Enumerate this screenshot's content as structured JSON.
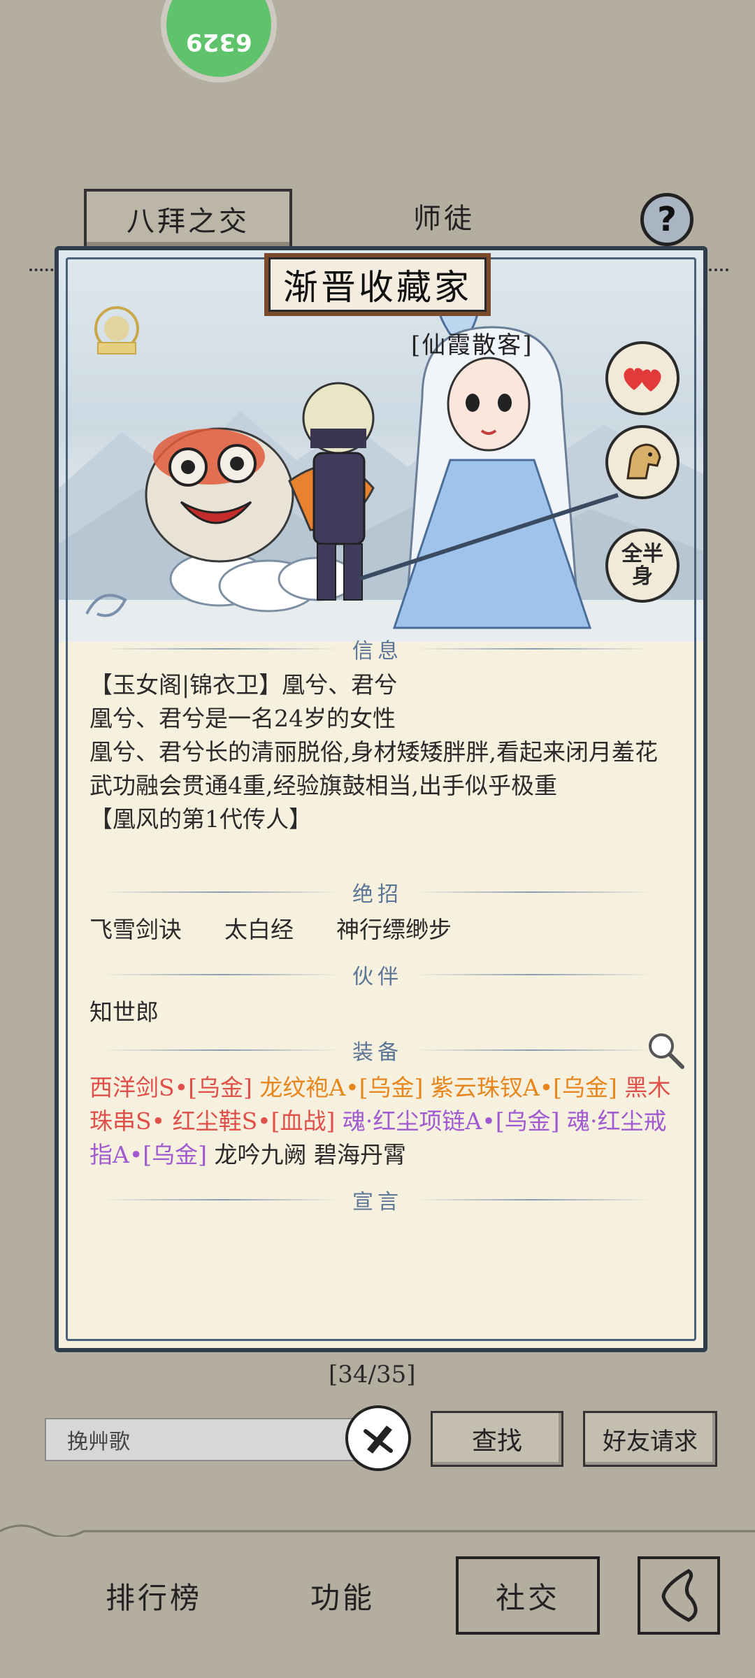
{
  "top_badge": {
    "value": "6329"
  },
  "tabs": [
    {
      "label": "八拜之交",
      "active": true
    },
    {
      "label": "师徒",
      "active": false
    }
  ],
  "help_label": "?",
  "card": {
    "title": "渐晋收藏家",
    "nickname": "[仙霞散客]",
    "side_buttons": {
      "body_toggle": "全半身"
    },
    "sections": {
      "info": "信息",
      "skills": "绝招",
      "partner": "伙伴",
      "equipment": "装备",
      "declaration": "宣言"
    },
    "info_lines": [
      "【玉女阁|锦衣卫】凰兮、君兮",
      "凰兮、君兮是一名24岁的女性",
      "凰兮、君兮长的清丽脱俗,身材矮矮胖胖,看起来闭月羞花",
      "武功融会贯通4重,经验旗鼓相当,出手似乎极重",
      "【凰风的第1代传人】"
    ],
    "skills": [
      "飞雪剑诀",
      "太白经",
      "神行缥缈步"
    ],
    "partner": "知世郎",
    "equipment": [
      {
        "text": "西洋剑S•[乌金]",
        "color": "red"
      },
      {
        "text": "龙纹袍A•[乌金]",
        "color": "orange"
      },
      {
        "text": "紫云珠钗A•[乌金]",
        "color": "orange"
      },
      {
        "text": "黑木珠串S•",
        "color": "red"
      },
      {
        "text": "红尘鞋S•[血战]",
        "color": "red"
      },
      {
        "text": "魂·红尘项链A•[乌金]",
        "color": "purple"
      },
      {
        "text": "魂·红尘戒指A•[乌金]",
        "color": "purple"
      },
      {
        "text": "龙吟九阙",
        "color": "dark"
      },
      {
        "text": "碧海丹霄",
        "color": "dark"
      }
    ]
  },
  "pagination": "[34/35]",
  "search": {
    "value": "挽艸歌",
    "find_label": "查找",
    "friend_request_label": "好友请求"
  },
  "bottom_nav": {
    "rank": "排行榜",
    "function": "功能",
    "social": "社交"
  },
  "colors": {
    "background": "#b4aea1",
    "card": "#f6f0de",
    "section": "#5c7596",
    "badge": "#5ec36a"
  }
}
